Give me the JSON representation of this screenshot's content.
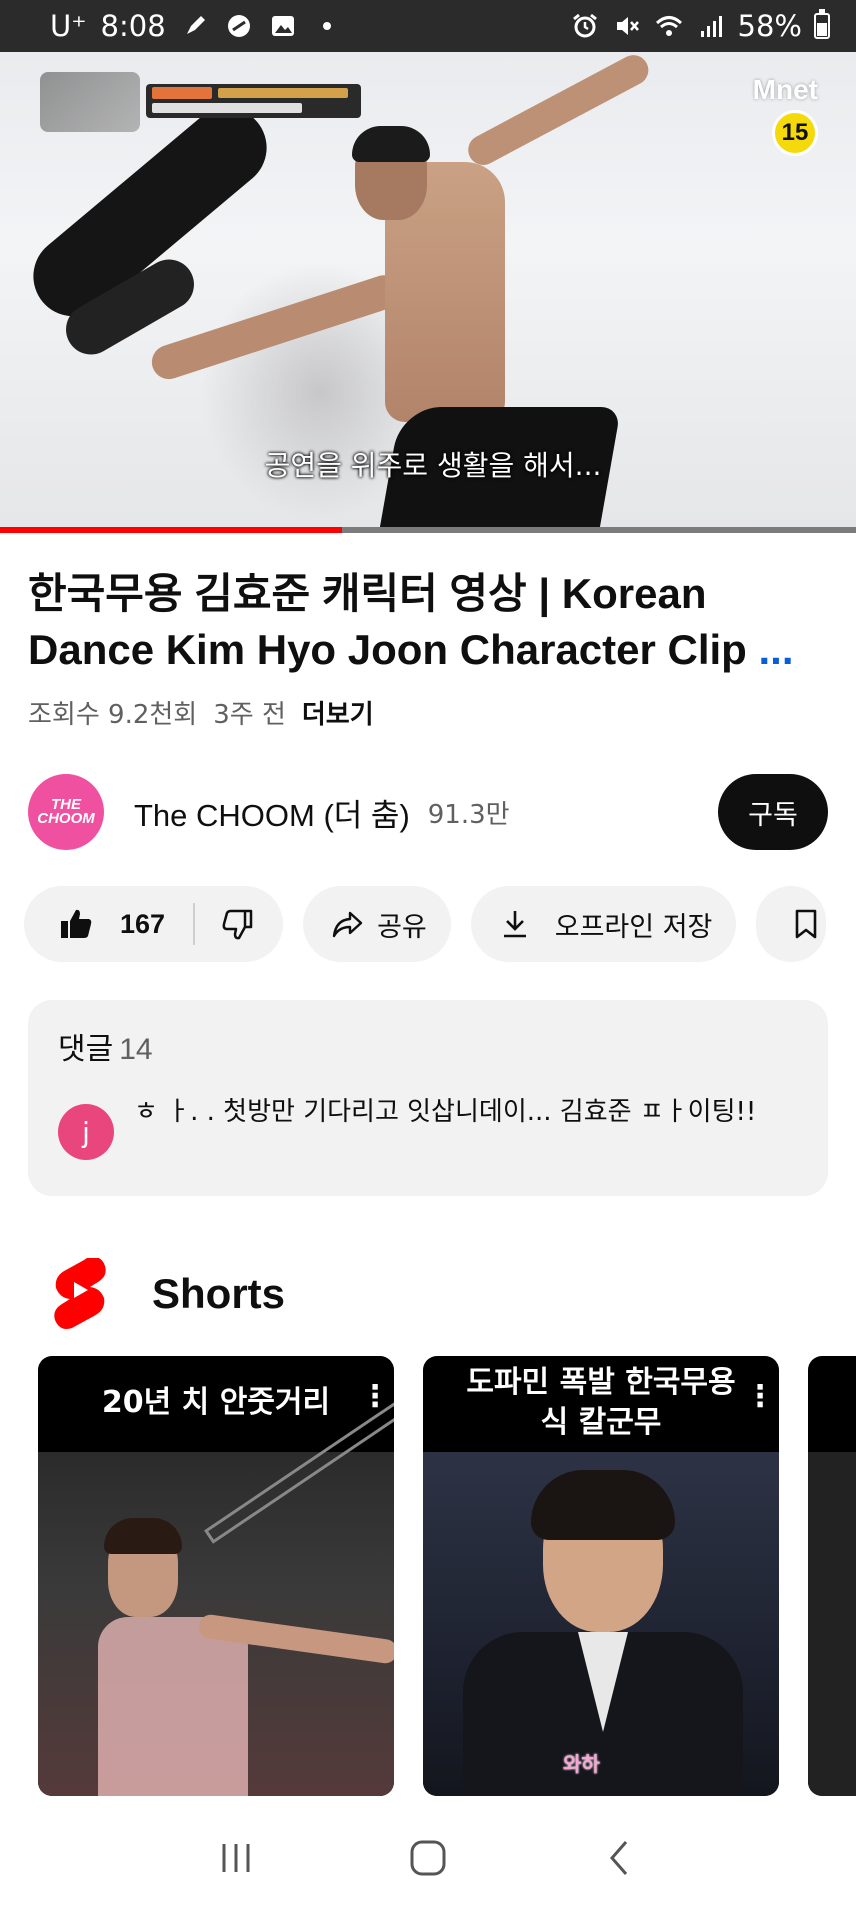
{
  "status_bar": {
    "carrier": "U⁺",
    "time": "8:08",
    "battery": "58%",
    "battery_level": 0.58,
    "icons_left": [
      "pen-icon",
      "circle-slash-icon",
      "image-icon",
      "dot-icon"
    ],
    "icons_right": [
      "alarm-icon",
      "mute-icon",
      "wifi-icon",
      "signal-icon",
      "battery-icon"
    ]
  },
  "player": {
    "subtitle": "공연을 위주로 생활을 해서...",
    "channel_logo": "Mnet",
    "age_rating": "15",
    "progress": 0.4
  },
  "video": {
    "title": "한국무용 김효준 캐릭터 영상 | Korean Dance Kim Hyo Joon Character Clip",
    "title_more": "...",
    "views": "조회수 9.2천회",
    "age": "3주 전",
    "more_label": "더보기"
  },
  "channel": {
    "avatar_text": "THE CHOOM",
    "name": "The CHOOM (더 춤)",
    "subscribers": "91.3만",
    "subscribe_label": "구독"
  },
  "actions": {
    "like_count": "167",
    "share_label": "공유",
    "offline_label": "오프라인 저장"
  },
  "comments": {
    "header": "댓글",
    "count": "14",
    "first": {
      "avatar_letter": "j",
      "text": "ㅎ ㅏ. . 첫방만 기다리고 잇삽니데이... 김효준 ㅍㅏ이팅!!"
    }
  },
  "shorts": {
    "title": "Shorts",
    "items": [
      {
        "title": "20년 치 안줏거리"
      },
      {
        "title": "도파민 폭발 한국무용식 칼군무",
        "overlay": "와하"
      },
      {
        "title": ""
      }
    ]
  },
  "colors": {
    "accent_red": "#ff0000",
    "link_blue": "#065fd4",
    "avatar_pink": "#f050a0",
    "comment_avatar": "#e8467c"
  }
}
